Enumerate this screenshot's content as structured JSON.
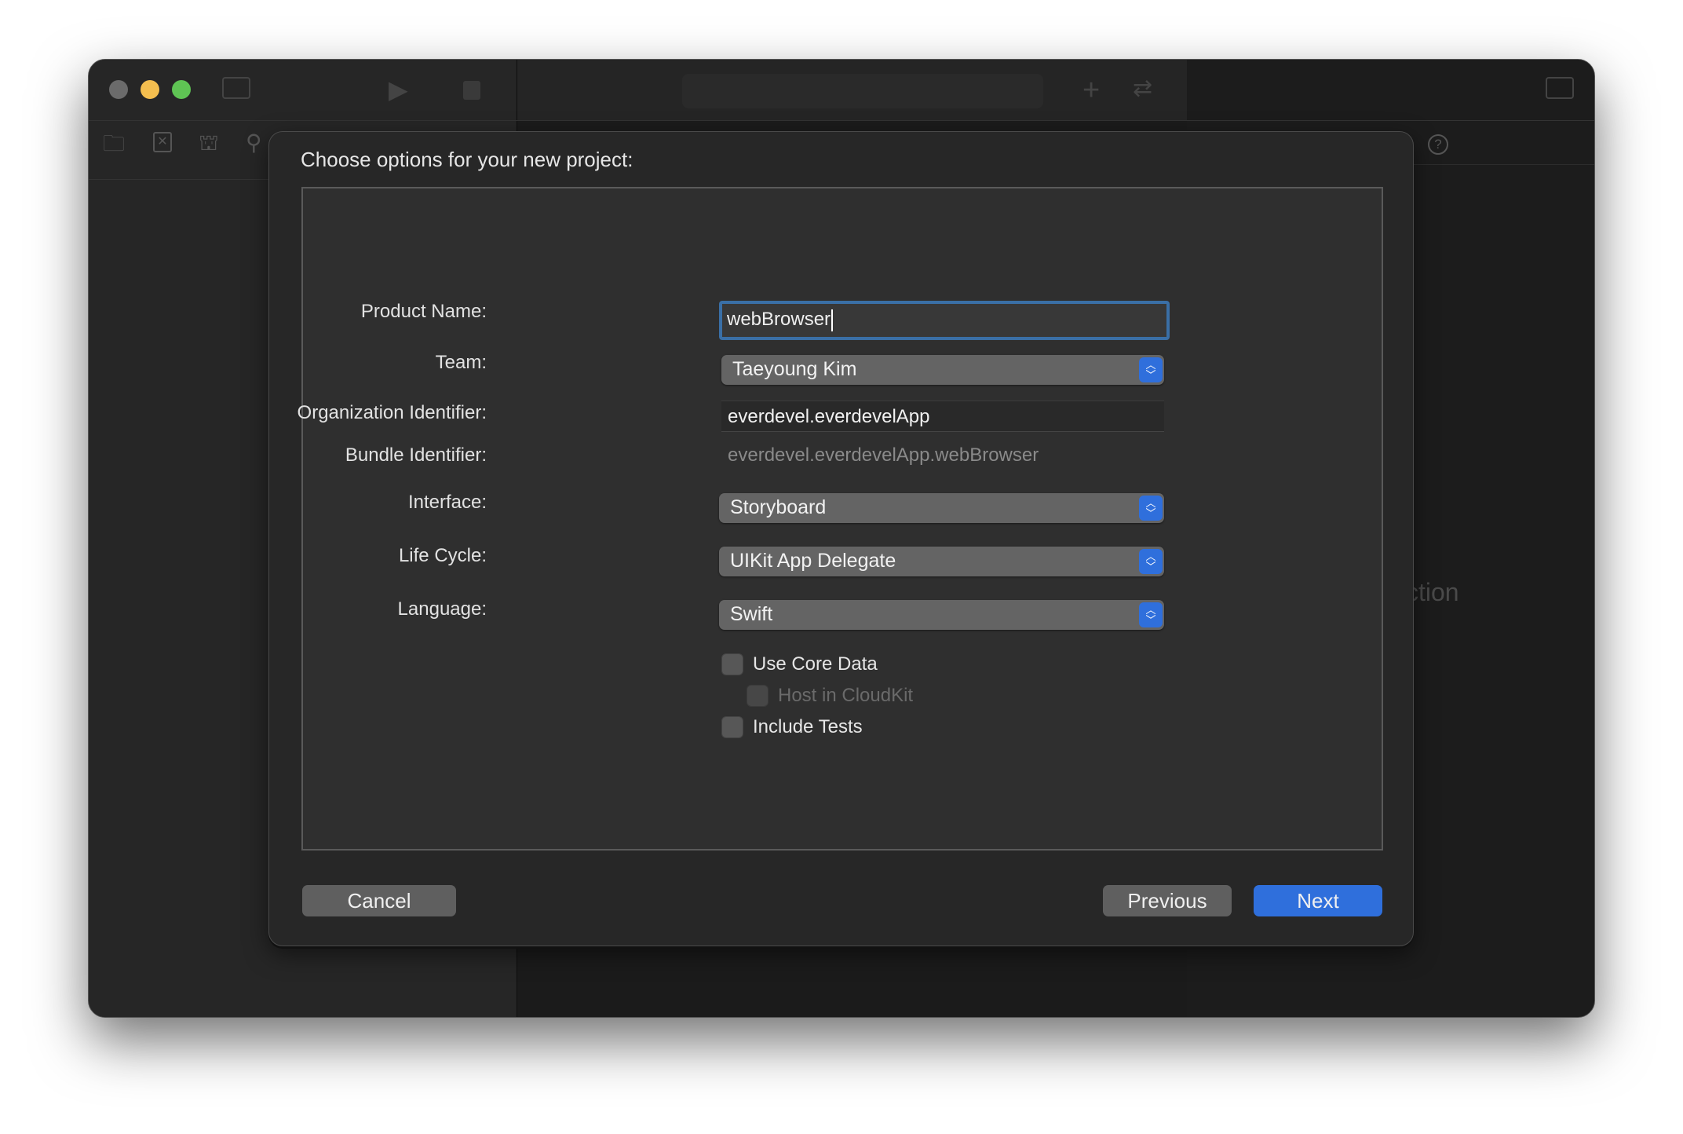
{
  "window": {
    "traffic_lights": {
      "close": "#6b6b6b",
      "minimize": "#f4be4f",
      "zoom": "#5fc454"
    },
    "background_text": "ction"
  },
  "toolbar": {
    "icons": [
      "sidebar-toggle-icon",
      "run-icon",
      "stop-icon",
      "add-icon",
      "swap-icon",
      "inspector-toggle-icon"
    ]
  },
  "navigator_icons": [
    "folder-icon",
    "xmark-box-icon",
    "hierarchy-icon",
    "search-icon",
    "help-icon"
  ],
  "dialog": {
    "title": "Choose options for your new project:",
    "fields": {
      "product_name": {
        "label": "Product Name:",
        "value": "webBrowser"
      },
      "team": {
        "label": "Team:",
        "value": "Taeyoung Kim"
      },
      "org_id": {
        "label": "Organization Identifier:",
        "value": "everdevel.everdevelApp"
      },
      "bundle_id": {
        "label": "Bundle Identifier:",
        "value": "everdevel.everdevelApp.webBrowser"
      },
      "interface": {
        "label": "Interface:",
        "value": "Storyboard"
      },
      "life_cycle": {
        "label": "Life Cycle:",
        "value": "UIKit App Delegate"
      },
      "language": {
        "label": "Language:",
        "value": "Swift"
      }
    },
    "checkboxes": {
      "core_data": {
        "label": "Use Core Data",
        "checked": false
      },
      "cloudkit": {
        "label": "Host in CloudKit",
        "checked": false,
        "disabled": true
      },
      "tests": {
        "label": "Include Tests",
        "checked": false
      }
    },
    "buttons": {
      "cancel": "Cancel",
      "previous": "Previous",
      "next": "Next"
    },
    "accent": "#2f6fdc"
  }
}
